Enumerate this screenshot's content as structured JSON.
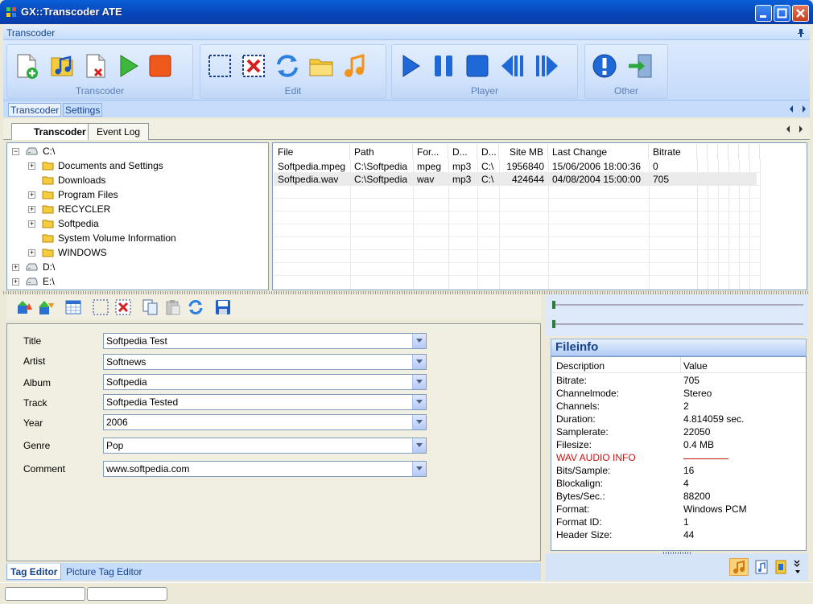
{
  "window": {
    "title": "GX::Transcoder ATE"
  },
  "ribbon": {
    "panel_title": "Transcoder",
    "groups": [
      {
        "label": "Transcoder",
        "icons": [
          "new-file-icon",
          "add-music-icon",
          "remove-file-icon",
          "play-green-icon",
          "stop-red-icon"
        ]
      },
      {
        "label": "Edit",
        "icons": [
          "select-box-icon",
          "delete-x-icon",
          "refresh-icon",
          "folder-icon",
          "music-note-icon"
        ]
      },
      {
        "label": "Player",
        "icons": [
          "play-icon",
          "pause-icon",
          "stop-icon",
          "previous-icon",
          "next-icon"
        ]
      },
      {
        "label": "Other",
        "icons": [
          "info-icon",
          "exit-icon"
        ]
      }
    ],
    "tabs": [
      "Transcoder",
      "Settings"
    ]
  },
  "doc_tabs": [
    "Transcoder",
    "Event Log"
  ],
  "tree": [
    {
      "label": "C:\\",
      "level": 0,
      "expander": "−",
      "type": "drive"
    },
    {
      "label": "Documents and Settings",
      "level": 1,
      "expander": "+",
      "type": "folder"
    },
    {
      "label": "Downloads",
      "level": 1,
      "expander": "",
      "type": "folder"
    },
    {
      "label": "Program Files",
      "level": 1,
      "expander": "+",
      "type": "folder"
    },
    {
      "label": "RECYCLER",
      "level": 1,
      "expander": "+",
      "type": "folder"
    },
    {
      "label": "Softpedia",
      "level": 1,
      "expander": "+",
      "type": "folder"
    },
    {
      "label": "System Volume Information",
      "level": 1,
      "expander": "",
      "type": "folder"
    },
    {
      "label": "WINDOWS",
      "level": 1,
      "expander": "+",
      "type": "folder"
    },
    {
      "label": "D:\\",
      "level": 0,
      "expander": "+",
      "type": "drive"
    },
    {
      "label": "E:\\",
      "level": 0,
      "expander": "+",
      "type": "drive"
    }
  ],
  "file_list": {
    "columns": [
      "File",
      "Path",
      "For...",
      "D...",
      "D...",
      "Site MB",
      "Last Change",
      "Bitrate"
    ],
    "rows": [
      [
        "Softpedia.mpeg",
        "C:\\Softpedia",
        "mpeg",
        "mp3",
        "C:\\",
        "1956840",
        "15/06/2006 18:00:36",
        "0"
      ],
      [
        "Softpedia.wav",
        "C:\\Softpedia",
        "wav",
        "mp3",
        "C:\\",
        "424644",
        "04/08/2004 15:00:00",
        "705"
      ]
    ]
  },
  "tag_editor": {
    "fields": [
      {
        "label": "Title",
        "value": "Softpedia Test"
      },
      {
        "label": "Artist",
        "value": "Softnews"
      },
      {
        "label": "Album",
        "value": "Softpedia"
      },
      {
        "label": "Track",
        "value": "Softpedia Tested"
      },
      {
        "label": "Year",
        "value": "2006"
      },
      {
        "label": "Genre",
        "value": "Pop"
      },
      {
        "label": "Comment",
        "value": "www.softpedia.com"
      }
    ],
    "tabs": [
      "Tag Editor",
      "Picture Tag Editor"
    ]
  },
  "fileinfo": {
    "title": "Fileinfo",
    "headers": [
      "Description",
      "Value"
    ],
    "rows": [
      {
        "desc": "Bitrate:",
        "value": "705"
      },
      {
        "desc": "Channelmode:",
        "value": "Stereo"
      },
      {
        "desc": "Channels:",
        "value": "2"
      },
      {
        "desc": "Duration:",
        "value": "4.814059 sec."
      },
      {
        "desc": "Samplerate:",
        "value": "22050"
      },
      {
        "desc": "Filesize:",
        "value": "0.4 MB"
      },
      {
        "desc": "WAV AUDIO INFO",
        "value": "",
        "highlight": true
      },
      {
        "desc": "Bits/Sample:",
        "value": "16"
      },
      {
        "desc": "Blockalign:",
        "value": "4"
      },
      {
        "desc": "Bytes/Sec.:",
        "value": "88200"
      },
      {
        "desc": "Format:",
        "value": "Windows PCM"
      },
      {
        "desc": "Format ID:",
        "value": "1"
      },
      {
        "desc": "Header Size:",
        "value": "44"
      }
    ]
  },
  "colors": {
    "accent": "#15428b",
    "highlight": "#cc1111",
    "selected_row": "#ebebeb"
  }
}
